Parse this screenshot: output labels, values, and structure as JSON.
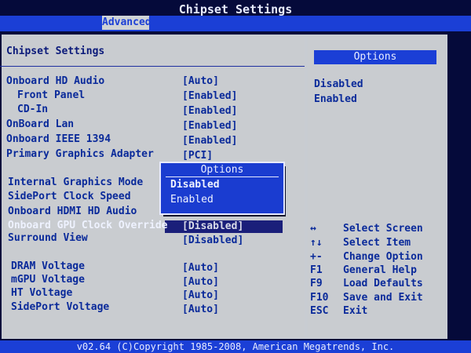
{
  "window": {
    "title": "Chipset Settings"
  },
  "tabs": {
    "active": "Advanced"
  },
  "left": {
    "section_title": "Chipset Settings",
    "rows": [
      {
        "label": "Onboard HD Audio",
        "value": "[Auto]"
      },
      {
        "label": "  Front Panel",
        "value": "[Enabled]"
      },
      {
        "label": "  CD-In",
        "value": "[Enabled]"
      },
      {
        "label": "OnBoard Lan",
        "value": "[Enabled]"
      },
      {
        "label": "Onboard IEEE 1394",
        "value": "[Enabled]"
      },
      {
        "label": "Primary Graphics Adapter",
        "value": "[PCI]"
      },
      {
        "label": "Internal Graphics Mode",
        "value": ""
      },
      {
        "label": "SidePort Clock Speed",
        "value": ""
      },
      {
        "label": "Onboard HDMI HD Audio",
        "value": ""
      },
      {
        "label": "Onboard GPU Clock Override",
        "value": "[Disabled]"
      },
      {
        "label": "Surround View",
        "value": "[Disabled]"
      },
      {
        "label": "DRAM Voltage",
        "value": "[Auto]"
      },
      {
        "label": "mGPU Voltage",
        "value": "[Auto]"
      },
      {
        "label": "HT Voltage",
        "value": "[Auto]"
      },
      {
        "label": "SidePort Voltage",
        "value": "[Auto]"
      }
    ]
  },
  "right": {
    "options_header": "Options",
    "options": [
      "Disabled",
      "Enabled"
    ],
    "keys": [
      {
        "key": "↔",
        "desc": "Select Screen"
      },
      {
        "key": "↑↓",
        "desc": "Select Item"
      },
      {
        "key": "+-",
        "desc": "Change Option"
      },
      {
        "key": "F1",
        "desc": "General Help"
      },
      {
        "key": "F9",
        "desc": "Load Defaults"
      },
      {
        "key": "F10",
        "desc": "Save and Exit"
      },
      {
        "key": "ESC",
        "desc": "Exit"
      }
    ]
  },
  "popup": {
    "title": "Options",
    "options": [
      "Disabled",
      "Enabled"
    ]
  },
  "footer": {
    "text": "v02.64 (C)Copyright 1985-2008, American Megatrends, Inc."
  }
}
